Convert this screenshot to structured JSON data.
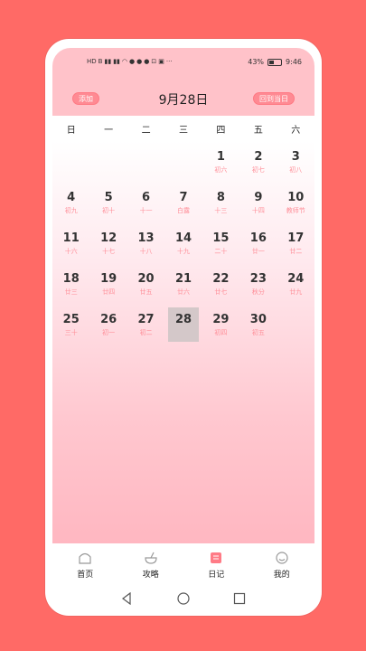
{
  "status": {
    "left_icons": [
      "HD",
      "B",
      "signal-icon",
      "signal-icon",
      "wifi-icon",
      "app-icon",
      "app-icon",
      "app-icon",
      "cart-icon",
      "app-icon",
      "..."
    ],
    "battery": "43%",
    "time": "9:46"
  },
  "header": {
    "add_label": "添加",
    "title": "9月28日",
    "today_label": "回到当日"
  },
  "weekdays": [
    "日",
    "一",
    "二",
    "三",
    "四",
    "五",
    "六"
  ],
  "calendar": {
    "days": [
      {
        "n": "1",
        "l": "初六"
      },
      {
        "n": "2",
        "l": "初七"
      },
      {
        "n": "3",
        "l": "初八"
      },
      {
        "n": "4",
        "l": "初九"
      },
      {
        "n": "5",
        "l": "初十"
      },
      {
        "n": "6",
        "l": "十一"
      },
      {
        "n": "7",
        "l": "白露"
      },
      {
        "n": "8",
        "l": "十三"
      },
      {
        "n": "9",
        "l": "十四"
      },
      {
        "n": "10",
        "l": "教师节"
      },
      {
        "n": "11",
        "l": "十六"
      },
      {
        "n": "12",
        "l": "十七"
      },
      {
        "n": "13",
        "l": "十八"
      },
      {
        "n": "14",
        "l": "十九"
      },
      {
        "n": "15",
        "l": "二十"
      },
      {
        "n": "16",
        "l": "廿一"
      },
      {
        "n": "17",
        "l": "廿二"
      },
      {
        "n": "18",
        "l": "廿三"
      },
      {
        "n": "19",
        "l": "廿四"
      },
      {
        "n": "20",
        "l": "廿五"
      },
      {
        "n": "21",
        "l": "廿六"
      },
      {
        "n": "22",
        "l": "廿七"
      },
      {
        "n": "23",
        "l": "秋分"
      },
      {
        "n": "24",
        "l": "廿九"
      },
      {
        "n": "25",
        "l": "三十"
      },
      {
        "n": "26",
        "l": "初一"
      },
      {
        "n": "27",
        "l": "初二"
      },
      {
        "n": "28",
        "l": ""
      },
      {
        "n": "29",
        "l": "初四"
      },
      {
        "n": "30",
        "l": "初五"
      }
    ],
    "selected": "28"
  },
  "tabs": [
    {
      "label": "首页",
      "icon": "home-icon"
    },
    {
      "label": "攻略",
      "icon": "guide-icon"
    },
    {
      "label": "日记",
      "icon": "diary-icon"
    },
    {
      "label": "我的",
      "icon": "profile-icon"
    }
  ],
  "colors": {
    "page_bg": "#ff6a66",
    "header_bg": "#ffc2c9",
    "accent": "#ff8a93",
    "lunar_text": "#ff8e98"
  }
}
